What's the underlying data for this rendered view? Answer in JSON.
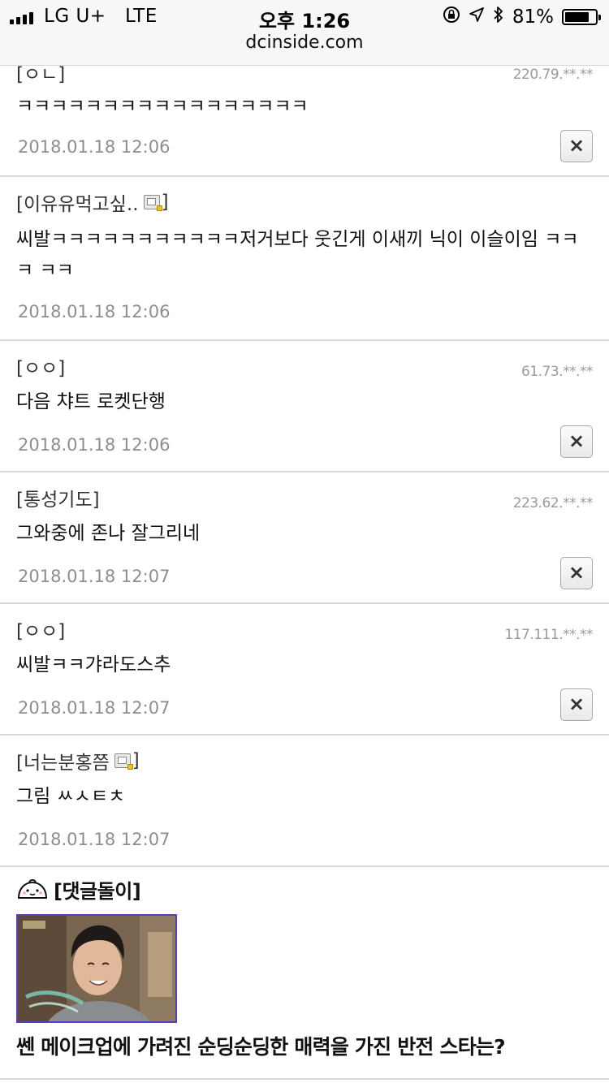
{
  "status_bar": {
    "carrier": "LG U+",
    "network": "LTE",
    "time": "오후 1:26",
    "battery": "81%",
    "battery_level": 0.81
  },
  "url_bar": {
    "domain": "dcinside.com"
  },
  "comments": [
    {
      "author": "[ㅇㄴ]",
      "ip": "220.79.**.**",
      "text": "ㅋㅋㅋㅋㅋㅋㅋㅋㅋㅋㅋㅋㅋㅋㅋㅋㅋ",
      "date": "2018.01.18 12:06",
      "delete": "×"
    },
    {
      "author_name": "[이유유먹고싶..",
      "author_close": "]",
      "text": "씨발ㅋㅋㅋㅋㅋㅋㅋㅋㅋㅋㅋ저거보다 웃긴게 이새끼 닉이 이슬이임 ㅋㅋㅋ ㅋㅋ",
      "date": "2018.01.18 12:06"
    },
    {
      "author": "[ㅇㅇ]",
      "ip": "61.73.**.**",
      "text": "다음 챠트 로켓단행",
      "date": "2018.01.18 12:06",
      "delete": "×"
    },
    {
      "author": "[통성기도]",
      "ip": "223.62.**.**",
      "text": "그와중에 존나 잘그리네",
      "date": "2018.01.18 12:07",
      "delete": "×"
    },
    {
      "author": "[ㅇㅇ]",
      "ip": "117.111.**.**",
      "text": "씨발ㅋㅋ갸라도스추",
      "date": "2018.01.18 12:07",
      "delete": "×"
    },
    {
      "author_name": "[너는분홍쯤",
      "author_close": "]",
      "text": "그림 ㅆㅅㅌㅊ",
      "date": "2018.01.18 12:07"
    }
  ],
  "promo": {
    "label": "[댓글돌이]",
    "headline": "쎈 메이크업에 가려진 순딩순딩한 매력을 가진 반전 스타는?"
  }
}
